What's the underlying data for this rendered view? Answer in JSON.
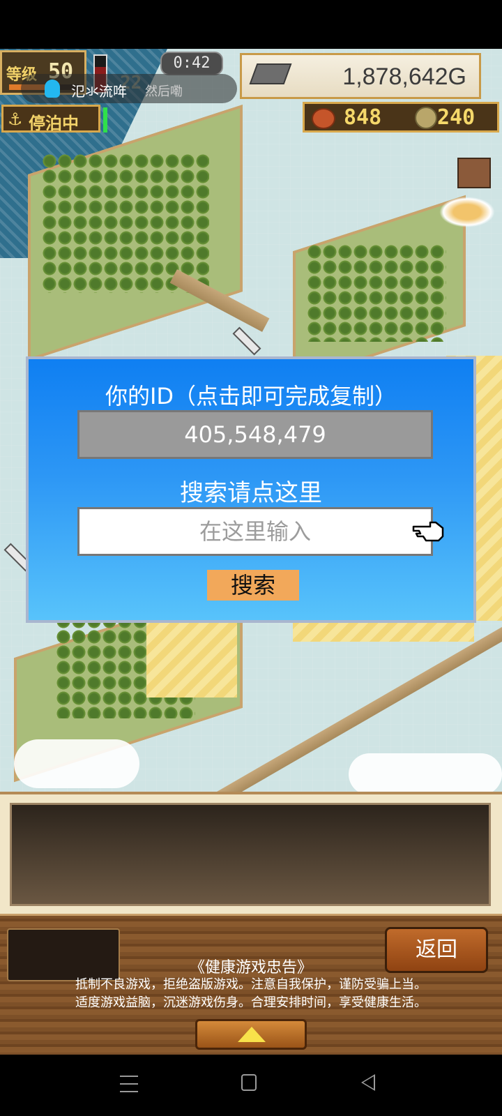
{
  "hud": {
    "level_label": "等级",
    "level": "50",
    "exp_progress": 0.55,
    "timer": "0:42",
    "dim_number": "22",
    "gold": "1,878,642G",
    "food": "848",
    "coins": "240",
    "anchor_status": "停泊中"
  },
  "notification": {
    "sender": "氾氺流哖",
    "message": "然后嘞"
  },
  "dialog": {
    "title": "你的ID（点击即可完成复制）",
    "id_value": "405,548,479",
    "search_hint": "搜索请点这里",
    "input_placeholder": "在这里输入",
    "search_button": "搜索"
  },
  "footer": {
    "back_button": "返回",
    "advice_title": "《健康游戏忠告》",
    "advice_line1": "抵制不良游戏，拒绝盗版游戏。注意自我保护，谨防受骗上当。",
    "advice_line2": "适度游戏益脑，沉迷游戏伤身。合理安排时间，享受健康生活。"
  },
  "colors": {
    "dialog_top": "#0f7ff2",
    "dialog_bottom": "#58c3fb",
    "search_button": "#f2a85a",
    "gold_text": "#f5d86a"
  },
  "icons": [
    "qq-icon",
    "gold-bar-icon",
    "meat-icon",
    "coin-icon",
    "anchor-icon",
    "pointing-hand-icon",
    "sword-icon",
    "up-arrow-icon"
  ]
}
